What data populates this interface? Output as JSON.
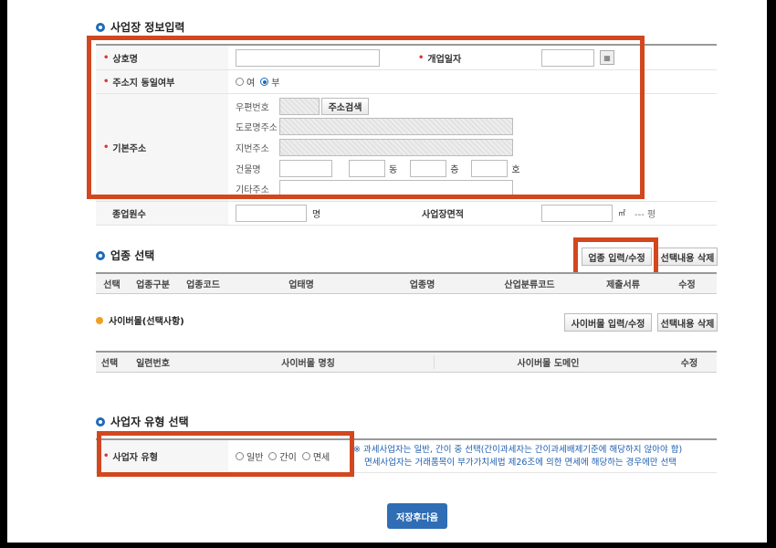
{
  "section1": {
    "title": "사업장 정보입력"
  },
  "fields": {
    "business_name": "상호명",
    "open_date": "개업일자",
    "calendar_icon": "calendar-icon",
    "same_address": "주소지 동일여부",
    "yes": "여",
    "no": "부",
    "basic_address": "기본주소",
    "postcode": "우편번호",
    "address_search": "주소검색",
    "road_address": "도로명주소",
    "lot_address": "지번주소",
    "building": "건물명",
    "dong": "동",
    "floor": "층",
    "ho": "호",
    "other_address": "기타주소",
    "employees": "종업원수",
    "employees_unit": "명",
    "area": "사업장면적",
    "area_unit": "㎡",
    "pyeong": "--- 평"
  },
  "section2": {
    "title": "업종 선택",
    "input_button": "업종 입력/수정",
    "delete_button": "선택내용 삭제",
    "columns": [
      "선택",
      "업종구분",
      "업종코드",
      "업태명",
      "업종명",
      "산업분류코드",
      "제출서류",
      "수정"
    ]
  },
  "cyber": {
    "title": "사이버몰(선택사항)",
    "input_button": "사이버몰 입력/수정",
    "delete_button": "선택내용 삭제",
    "columns": [
      "선택",
      "일련번호",
      "사이버몰 명칭",
      "사이버몰 도메인",
      "수정"
    ]
  },
  "section3": {
    "title": "사업자 유형 선택",
    "label": "사업자 유형",
    "options": [
      "일반",
      "간이",
      "면세"
    ],
    "note1": "※ 과세사업자는 일반, 간이 중 선택(간이과세자는 간이과세배제기준에 해당하지 않아야 함)",
    "note2": "면세사업자는 거래품목이 부가가치세법 제26조에 의한 면세에 해당하는 경우에만 선택"
  },
  "save_button": "저장후다음",
  "colors": {
    "accent": "#2f6db5",
    "highlight": "#d2471f",
    "required": "#dd3333"
  }
}
